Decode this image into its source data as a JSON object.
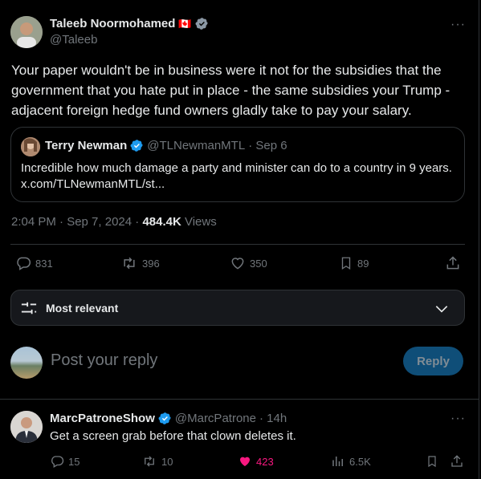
{
  "tweet": {
    "author_name": "Taleeb Noormohamed",
    "author_handle": "@Taleeb",
    "flag": "🇨🇦",
    "text": "Your paper wouldn't be in business were it not for the subsidies that the government that you hate put in place - the same subsidies your Trump - adjacent foreign hedge fund owners gladly take to pay your salary.",
    "time": "2:04 PM · Sep 7, 2024 · ",
    "views_count": "484.4K",
    "views_label": "Views"
  },
  "quote": {
    "author_name": "Terry Newman",
    "author_handle": "@TLNewmanMTL",
    "date": "· Sep 6",
    "text": "Incredible how much damage a party and minister can do to a country in 9 years. x.com/TLNewmanMTL/st..."
  },
  "actions": {
    "replies": "831",
    "reposts": "396",
    "likes": "350",
    "bookmarks": "89"
  },
  "sort": {
    "label": "Most relevant"
  },
  "composer": {
    "placeholder": "Post your reply",
    "button": "Reply"
  },
  "reply": {
    "author_name": "MarcPatroneShow",
    "author_handle": "@MarcPatrone",
    "time": "· 14h",
    "text": "Get a screen grab before that clown deletes it.",
    "replies": "15",
    "reposts": "10",
    "likes": "423",
    "views": "6.5K"
  },
  "colors": {
    "background": "#000000",
    "text": "#e7e9ea",
    "muted": "#71767b",
    "verified": "#1d9bf0",
    "like_active": "#f91880",
    "reply_button": "#0f4e78"
  },
  "icons": [
    "more-icon",
    "verified-icon",
    "reply-icon",
    "repost-icon",
    "like-icon",
    "bookmark-icon",
    "share-icon",
    "views-icon",
    "filter-icon",
    "chevron-down-icon"
  ]
}
